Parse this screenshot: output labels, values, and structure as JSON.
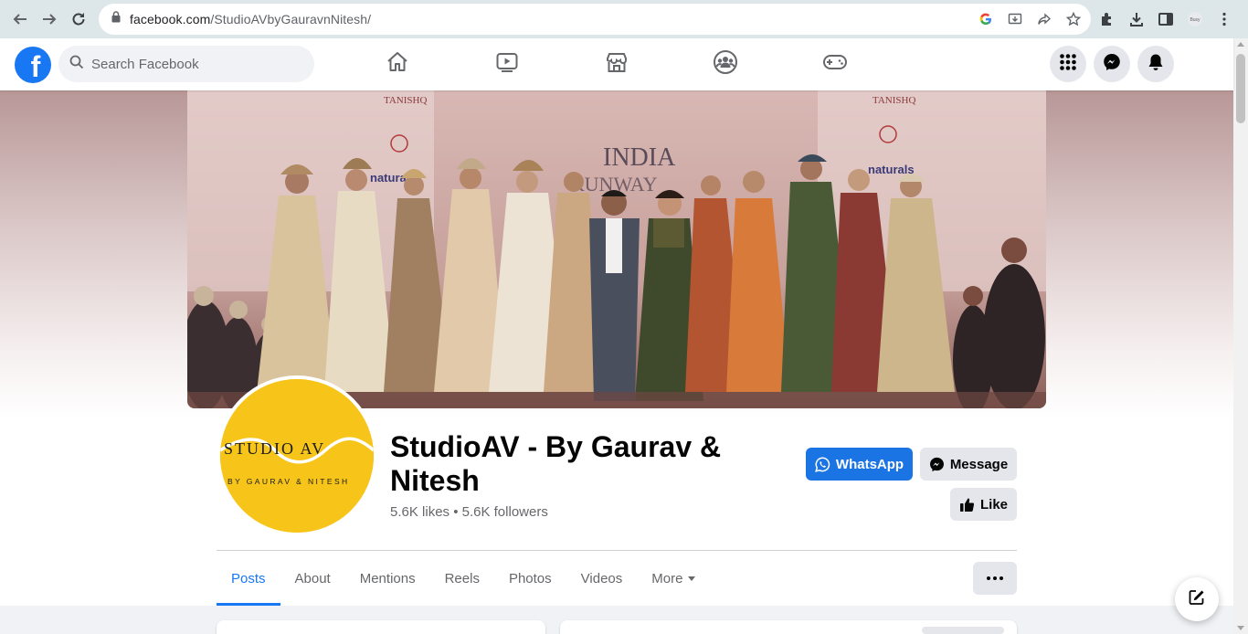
{
  "browser": {
    "url_host": "facebook.com",
    "url_path": "/StudioAVbyGauravnNitesh/"
  },
  "topbar": {
    "logo_letter": "f",
    "search_placeholder": "Search Facebook"
  },
  "page": {
    "name": "StudioAV - By Gaurav & Nitesh",
    "stats": "5.6K likes • 5.6K followers",
    "logo_text_main": "STUDIO AV",
    "logo_text_sub": "BY GAURAV & NITESH"
  },
  "cover": {
    "sign_left": "TANISHQ",
    "sign_center_1": "INDIA",
    "sign_center_2": "RUNWAY",
    "sign_right": "naturals"
  },
  "actions": {
    "whatsapp_label": "WhatsApp",
    "message_label": "Message",
    "like_label": "Like"
  },
  "tabs": [
    {
      "label": "Posts"
    },
    {
      "label": "About"
    },
    {
      "label": "Mentions"
    },
    {
      "label": "Reels"
    },
    {
      "label": "Photos"
    },
    {
      "label": "Videos"
    },
    {
      "label": "More"
    }
  ],
  "colors": {
    "brand": "#1877f2",
    "logo_yellow": "#f7c51a"
  }
}
